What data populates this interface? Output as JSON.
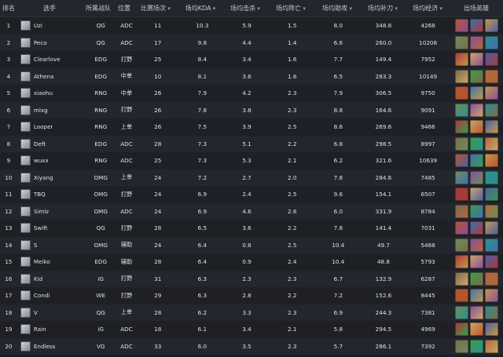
{
  "header": {
    "rank": "排名",
    "player": "选手",
    "team": "所属战队",
    "position": "位置",
    "games": "比赛场次",
    "kda": "场均KDA",
    "kills": "场均击杀",
    "deaths": "场均阵亡",
    "assists": "场均助攻",
    "cs": "场均补刀",
    "gold": "场均经济",
    "heroes": "出场英雄"
  },
  "rows": [
    {
      "rank": "1",
      "player": "Uzi",
      "team": "QG",
      "position": "ADC",
      "games": "11",
      "kda": "10.3",
      "kills": "5.9",
      "deaths": "1.5",
      "assists": "8.0",
      "cs": "348.8",
      "gold": "4268"
    },
    {
      "rank": "2",
      "player": "Peco",
      "team": "QG",
      "position": "ADC",
      "games": "17",
      "kda": "9.8",
      "kills": "4.4",
      "deaths": "1.4",
      "assists": "6.6",
      "cs": "260.0",
      "gold": "10208"
    },
    {
      "rank": "3",
      "player": "Clearlove",
      "team": "EDG",
      "position": "打野",
      "games": "25",
      "kda": "8.4",
      "kills": "3.4",
      "deaths": "1.6",
      "assists": "7.7",
      "cs": "149.4",
      "gold": "7952"
    },
    {
      "rank": "4",
      "player": "Athena",
      "team": "EDG",
      "position": "中单",
      "games": "10",
      "kda": "8.1",
      "kills": "3.6",
      "deaths": "1.6",
      "assists": "6.5",
      "cs": "283.3",
      "gold": "10149"
    },
    {
      "rank": "5",
      "player": "xiaohu",
      "team": "RNG",
      "position": "中单",
      "games": "26",
      "kda": "7.9",
      "kills": "4.2",
      "deaths": "2.3",
      "assists": "7.9",
      "cs": "306.5",
      "gold": "9750"
    },
    {
      "rank": "6",
      "player": "mlxg",
      "team": "RNG",
      "position": "打野",
      "games": "26",
      "kda": "7.8",
      "kills": "3.8",
      "deaths": "2.3",
      "assists": "8.8",
      "cs": "164.6",
      "gold": "9091"
    },
    {
      "rank": "7",
      "player": "Looper",
      "team": "RNG",
      "position": "上单",
      "games": "26",
      "kda": "7.5",
      "kills": "3.9",
      "deaths": "2.5",
      "assists": "8.6",
      "cs": "269.6",
      "gold": "9466"
    },
    {
      "rank": "8",
      "player": "Deft",
      "team": "EDG",
      "position": "ADC",
      "games": "28",
      "kda": "7.3",
      "kills": "5.1",
      "deaths": "2.2",
      "assists": "6.8",
      "cs": "298.5",
      "gold": "8997"
    },
    {
      "rank": "9",
      "player": "wuxx",
      "team": "RNG",
      "position": "ADC",
      "games": "25",
      "kda": "7.3",
      "kills": "5.3",
      "deaths": "2.1",
      "assists": "6.2",
      "cs": "321.6",
      "gold": "10639"
    },
    {
      "rank": "10",
      "player": "Xiyang",
      "team": "OMG",
      "position": "上单",
      "games": "24",
      "kda": "7.2",
      "kills": "2.7",
      "deaths": "2.0",
      "assists": "7.8",
      "cs": "284.6",
      "gold": "7485"
    },
    {
      "rank": "11",
      "player": "TBQ",
      "team": "OMG",
      "position": "打野",
      "games": "24",
      "kda": "6.9",
      "kills": "2.4",
      "deaths": "2.5",
      "assists": "9.6",
      "cs": "154.1",
      "gold": "6507"
    },
    {
      "rank": "12",
      "player": "Simlz",
      "team": "OMG",
      "position": "ADC",
      "games": "24",
      "kda": "6.9",
      "kills": "4.6",
      "deaths": "2.6",
      "assists": "6.0",
      "cs": "331.9",
      "gold": "8784"
    },
    {
      "rank": "13",
      "player": "Swift",
      "team": "QG",
      "position": "打野",
      "games": "28",
      "kda": "6.5",
      "kills": "3.6",
      "deaths": "2.2",
      "assists": "7.8",
      "cs": "141.4",
      "gold": "7031"
    },
    {
      "rank": "14",
      "player": "S",
      "team": "OMG",
      "position": "辅助",
      "games": "24",
      "kda": "6.4",
      "kills": "0.8",
      "deaths": "2.5",
      "assists": "10.4",
      "cs": "49.7",
      "gold": "5468"
    },
    {
      "rank": "15",
      "player": "Meiko",
      "team": "EDG",
      "position": "辅助",
      "games": "28",
      "kda": "6.4",
      "kills": "0.9",
      "deaths": "2.4",
      "assists": "10.4",
      "cs": "48.8",
      "gold": "5793"
    },
    {
      "rank": "16",
      "player": "Kid",
      "team": "iG",
      "position": "打野",
      "games": "31",
      "kda": "6.3",
      "kills": "2.3",
      "deaths": "2.3",
      "assists": "6.7",
      "cs": "132.9",
      "gold": "6287"
    },
    {
      "rank": "17",
      "player": "Condi",
      "team": "WE",
      "position": "打野",
      "games": "29",
      "kda": "6.3",
      "kills": "2.8",
      "deaths": "2.2",
      "assists": "7.2",
      "cs": "152.6",
      "gold": "8445"
    },
    {
      "rank": "18",
      "player": "V",
      "team": "QG",
      "position": "上单",
      "games": "28",
      "kda": "6.2",
      "kills": "3.3",
      "deaths": "2.3",
      "assists": "6.9",
      "cs": "244.3",
      "gold": "7381"
    },
    {
      "rank": "19",
      "player": "Rain",
      "team": "iG",
      "position": "ADC",
      "games": "18",
      "kda": "6.1",
      "kills": "3.4",
      "deaths": "2.1",
      "assists": "5.8",
      "cs": "294.5",
      "gold": "4969"
    },
    {
      "rank": "20",
      "player": "Endless",
      "team": "VG",
      "position": "ADC",
      "games": "33",
      "kda": "6.0",
      "kills": "3.5",
      "deaths": "2.3",
      "assists": "5.7",
      "cs": "286.1",
      "gold": "7392"
    }
  ],
  "hero_palette": [
    "#b5542f",
    "#3f6fb0",
    "#c79a4a",
    "#6b8f5a",
    "#8a4d9c",
    "#2f8f8c",
    "#a63a3a",
    "#cfa86a",
    "#4b5ea8",
    "#7c6a4a",
    "#3e9a4b",
    "#b0683c"
  ]
}
